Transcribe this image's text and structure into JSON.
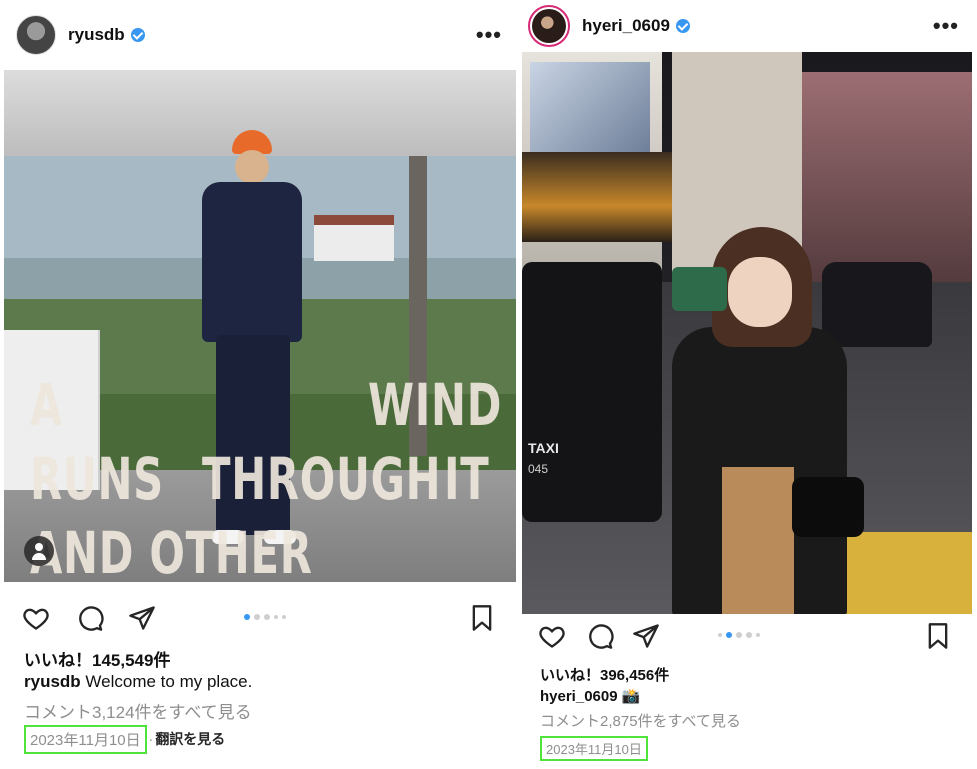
{
  "posts": [
    {
      "username": "ryusdb",
      "overlay": {
        "line1_left": "A",
        "line1_right": "WIND",
        "line2a": "RUNS",
        "line2b": "THROUGH",
        "line2c": "IT",
        "line3": "AND OTHER STORIES"
      },
      "likes": "いいね！145,549件",
      "caption_user": "ryusdb",
      "caption_text": " Welcome to my place.",
      "comments": "コメント3,124件をすべて見る",
      "date": "2023年11月10日",
      "separator": "·",
      "translate": "翻訳を見る",
      "carousel": {
        "count": 5,
        "active": 1
      }
    },
    {
      "username": "hyeri_0609",
      "taxi_text": "TAXI",
      "taxi_num": "045",
      "likes": "いいね！396,456件",
      "caption_user": "hyeri_0609",
      "caption_emoji": "📸",
      "comments": "コメント2,875件をすべて見る",
      "date": "2023年11月10日",
      "carousel": {
        "count": 5,
        "active": 2
      }
    }
  ],
  "icons": [
    "heart-icon",
    "comment-icon",
    "share-icon",
    "bookmark-icon",
    "more-icon",
    "verified-icon",
    "user-tag-icon"
  ],
  "colors": {
    "highlight": "#4fe33b",
    "verified": "#3897f0",
    "muted": "#8e8e8e",
    "carousel_active": "#3897f0"
  }
}
